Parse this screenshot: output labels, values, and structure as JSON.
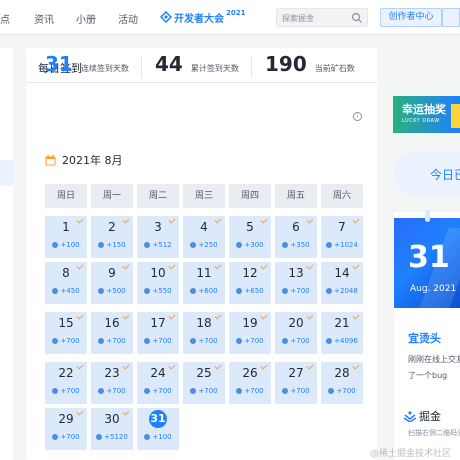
{
  "header": {
    "nav": [
      "热点",
      "资讯",
      "小册",
      "活动"
    ],
    "brand": {
      "name": "开发者大会",
      "year": "2021"
    },
    "search_placeholder": "探索掘金",
    "creator_label": "创作者中心"
  },
  "main": {
    "title": "每日签到",
    "stats": [
      {
        "value": "31",
        "label": "连续签到天数"
      },
      {
        "value": "44",
        "label": "累计签到天数"
      },
      {
        "value": "190",
        "label": "当前矿石数"
      }
    ],
    "info_icon_glyph": "i",
    "calendar": {
      "month_label": "2021年 8月",
      "weekdays": [
        "周日",
        "周一",
        "周二",
        "周三",
        "周四",
        "周五",
        "周六"
      ],
      "days": [
        {
          "day": "1",
          "reward": "+100"
        },
        {
          "day": "2",
          "reward": "+150"
        },
        {
          "day": "3",
          "reward": "+512"
        },
        {
          "day": "4",
          "reward": "+250"
        },
        {
          "day": "5",
          "reward": "+300"
        },
        {
          "day": "6",
          "reward": "+350"
        },
        {
          "day": "7",
          "reward": "+1024"
        },
        {
          "day": "8",
          "reward": "+450"
        },
        {
          "day": "9",
          "reward": "+500"
        },
        {
          "day": "10",
          "reward": "+550"
        },
        {
          "day": "11",
          "reward": "+600"
        },
        {
          "day": "12",
          "reward": "+650"
        },
        {
          "day": "13",
          "reward": "+700"
        },
        {
          "day": "14",
          "reward": "+2048"
        },
        {
          "day": "15",
          "reward": "+700"
        },
        {
          "day": "16",
          "reward": "+700"
        },
        {
          "day": "17",
          "reward": "+700"
        },
        {
          "day": "18",
          "reward": "+700"
        },
        {
          "day": "19",
          "reward": "+700"
        },
        {
          "day": "20",
          "reward": "+700"
        },
        {
          "day": "21",
          "reward": "+4096"
        },
        {
          "day": "22",
          "reward": "+700"
        },
        {
          "day": "23",
          "reward": "+700"
        },
        {
          "day": "24",
          "reward": "+700"
        },
        {
          "day": "25",
          "reward": "+700"
        },
        {
          "day": "26",
          "reward": "+700"
        },
        {
          "day": "27",
          "reward": "+700"
        },
        {
          "day": "28",
          "reward": "+700"
        },
        {
          "day": "29",
          "reward": "+700"
        },
        {
          "day": "30",
          "reward": "+5120"
        },
        {
          "day": "31",
          "reward": "+100",
          "today": true
        }
      ]
    }
  },
  "side": {
    "lottery_title": "幸运抽奖",
    "lottery_subtitle": "LUCKY DRAW",
    "today_label": "今日已",
    "share": {
      "day": "31",
      "date": "Aug. 2021",
      "quote": "宜烫头",
      "lines": [
        "刚刚在线上交友",
        "了一个bug"
      ],
      "brand": "掘金",
      "hint": "扫描右侧二维码分享"
    }
  },
  "watermark": "@稀土掘金技术社区",
  "colors": {
    "accent": "#1e80ff",
    "check": "#ff9d2e",
    "day_bg": "#dbe9fb"
  }
}
